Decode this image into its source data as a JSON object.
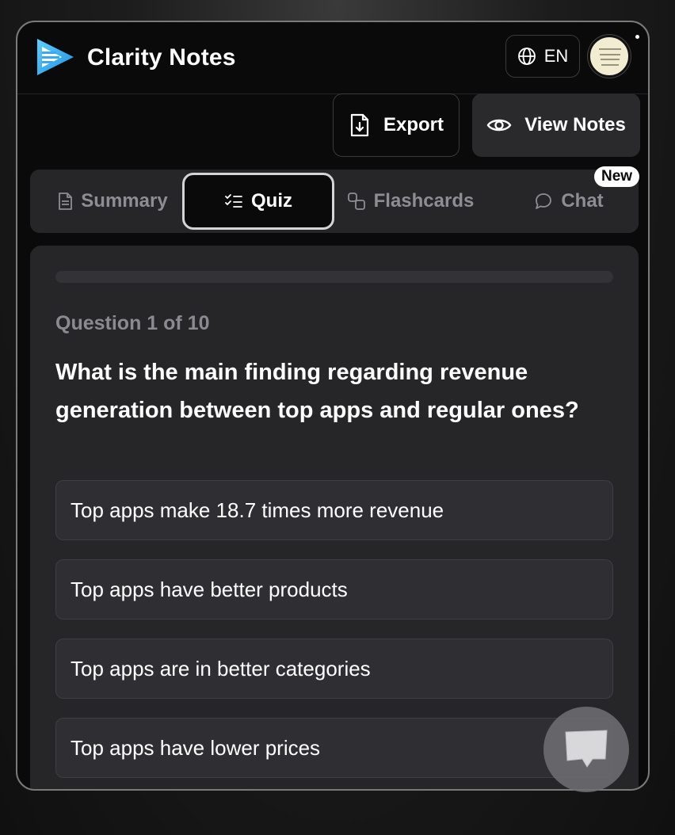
{
  "app": {
    "title": "Clarity Notes",
    "brand_color": "#2aa9f0"
  },
  "header": {
    "language": "EN",
    "language_icon": "globe-icon"
  },
  "actions": {
    "export_label": "Export",
    "export_icon": "file-download-icon",
    "view_notes_label": "View Notes",
    "view_notes_icon": "eye-icon"
  },
  "tabs": [
    {
      "label": "Summary",
      "icon": "document-icon",
      "active": false
    },
    {
      "label": "Quiz",
      "icon": "checklist-icon",
      "active": true
    },
    {
      "label": "Flashcards",
      "icon": "cards-icon",
      "active": false
    },
    {
      "label": "Chat",
      "icon": "speech-bubble-icon",
      "active": false
    }
  ],
  "badge": {
    "new_label": "New"
  },
  "quiz": {
    "progress_percent": 0,
    "counter": "Question 1 of 10",
    "question": "What is the main finding regarding revenue generation between top apps and regular ones?",
    "options": [
      "Top apps make 18.7 times more revenue",
      "Top apps have better products",
      "Top apps are in better categories",
      "Top apps have lower prices"
    ]
  },
  "fab": {
    "icon": "chat-bubble-icon"
  }
}
